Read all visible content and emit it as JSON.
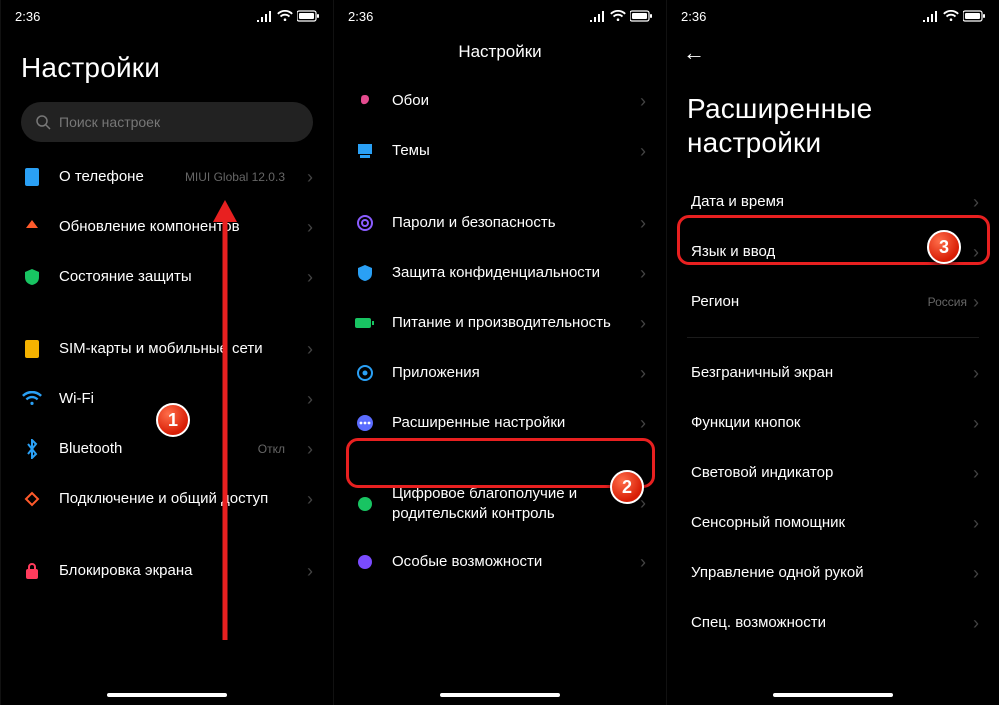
{
  "status": {
    "time": "2:36"
  },
  "p1": {
    "title": "Настройки",
    "search_placeholder": "Поиск настроек",
    "about_phone": "О телефоне",
    "about_value": "MIUI Global 12.0.3",
    "updates": "Обновление компонентов",
    "security_status": "Состояние защиты",
    "sim": "SIM-карты и мобильные сети",
    "wifi": "Wi-Fi",
    "bluetooth": "Bluetooth",
    "bluetooth_value": "Откл",
    "connection": "Подключение и общий доступ",
    "lockscreen": "Блокировка экрана"
  },
  "p2": {
    "title": "Настройки",
    "wallpaper": "Обои",
    "themes": "Темы",
    "passwords": "Пароли и безопасность",
    "privacy": "Защита конфиденциальности",
    "battery": "Питание и производительность",
    "apps": "Приложения",
    "advanced": "Расширенные настройки",
    "wellbeing": "Цифровое благополучие и родительский контроль",
    "accessibility": "Особые возможности"
  },
  "p3": {
    "title": "Расширенные настройки",
    "date": "Дата и время",
    "language": "Язык и ввод",
    "region": "Регион",
    "region_value": "Россия",
    "fullscreen": "Безграничный экран",
    "buttons": "Функции кнопок",
    "led": "Световой индикатор",
    "touch_assist": "Сенсорный помощник",
    "onehand": "Управление одной рукой",
    "special": "Спец. возможности"
  },
  "badges": {
    "b1": "1",
    "b2": "2",
    "b3": "3"
  }
}
